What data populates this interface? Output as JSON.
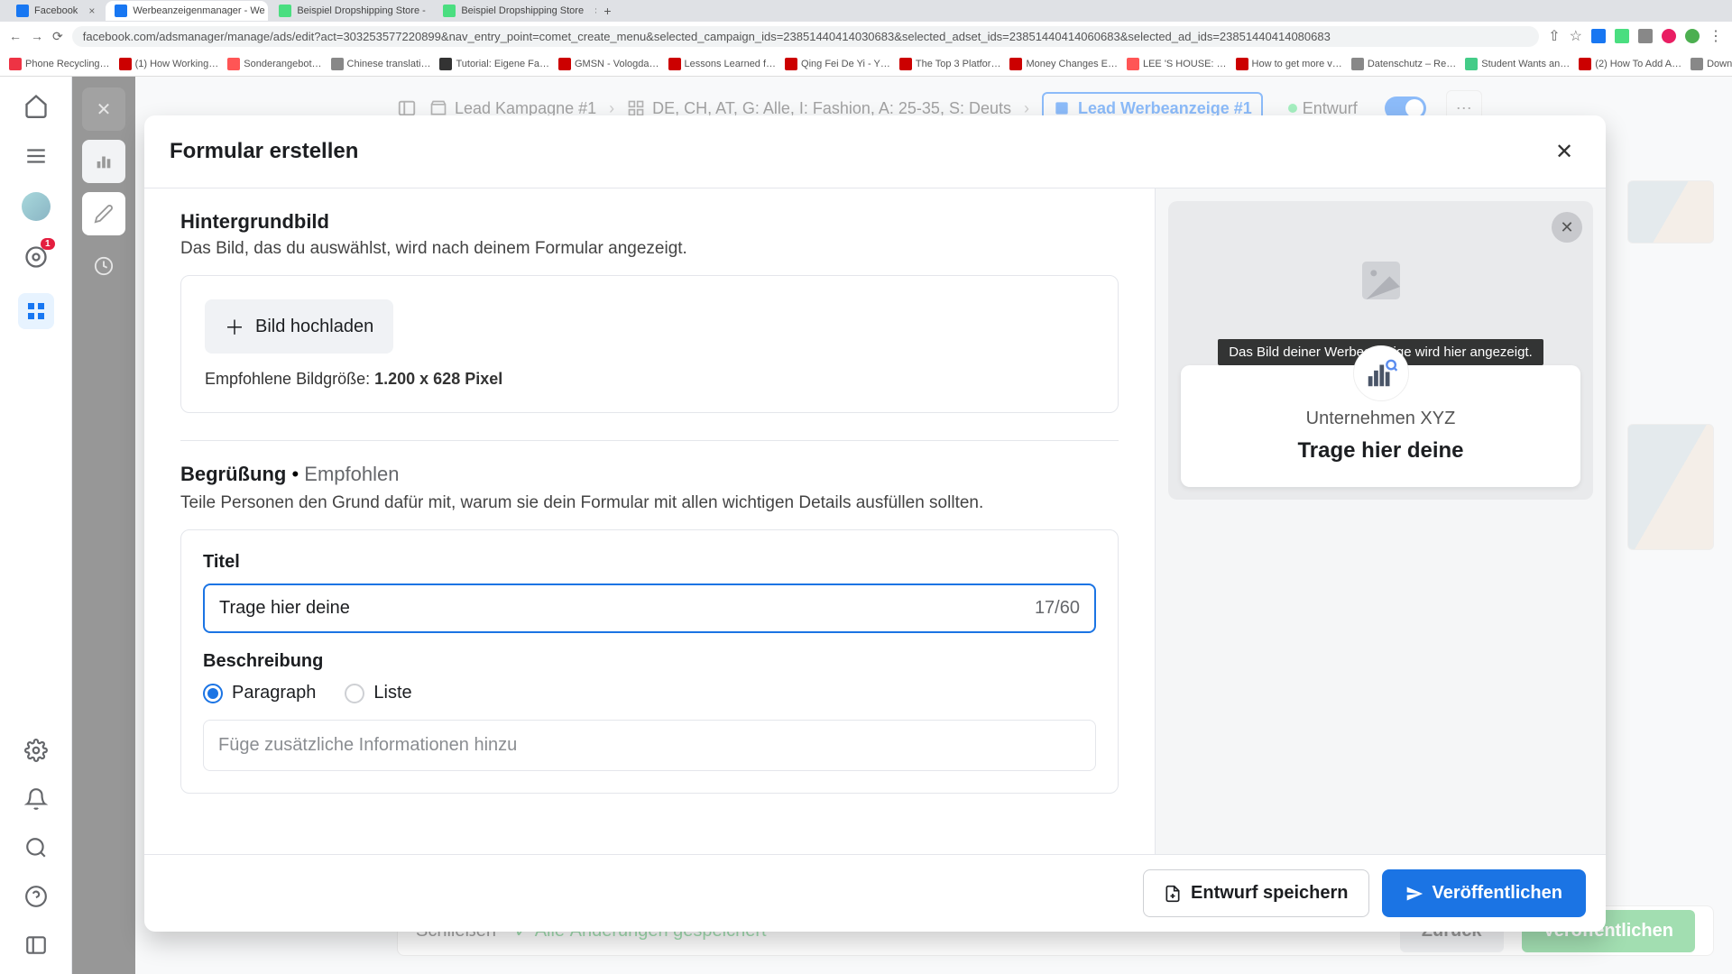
{
  "browser": {
    "tabs": [
      {
        "label": "Facebook"
      },
      {
        "label": "Werbeanzeigenmanager - We"
      },
      {
        "label": "Beispiel Dropshipping Store -"
      },
      {
        "label": "Beispiel Dropshipping Store"
      }
    ],
    "url": "facebook.com/adsmanager/manage/ads/edit?act=303253577220899&nav_entry_point=comet_create_menu&selected_campaign_ids=23851440414030683&selected_adset_ids=23851440414060683&selected_ad_ids=23851440414080683",
    "bookmarks": [
      "Phone Recycling…",
      "(1) How Working…",
      "Sonderangebot…",
      "Chinese translati…",
      "Tutorial: Eigene Fa…",
      "GMSN - Vologda…",
      "Lessons Learned f…",
      "Qing Fei De Yi - Y…",
      "The Top 3 Platfor…",
      "Money Changes E…",
      "LEE 'S HOUSE: …",
      "How to get more v…",
      "Datenschutz – Re…",
      "Student Wants an…",
      "(2) How To Add A…",
      "Download - Cooki…"
    ]
  },
  "fb_rail": {
    "notification_count": "1"
  },
  "editor_bar": {
    "crumb1": "Lead Kampagne #1",
    "crumb2": "DE, CH, AT, G: Alle, I: Fashion, A: 25-35, S: Deuts",
    "crumb3": "Lead Werbeanzeige #1",
    "status": "Entwurf"
  },
  "bottom_bar": {
    "close": "Schließen",
    "saved": "Alle Änderungen gespeichert",
    "back": "Zurück",
    "publish": "Veröffentlichen"
  },
  "modal": {
    "title": "Formular erstellen",
    "bg_section": {
      "title": "Hintergrundbild",
      "subtitle": "Das Bild, das du auswählst, wird nach deinem Formular angezeigt.",
      "upload_label": "Bild hochladen",
      "rec_prefix": "Empfohlene Bildgröße: ",
      "rec_value": "1.200 x 628 Pixel"
    },
    "greet_section": {
      "title": "Begrüßung",
      "sep": " • ",
      "rec": "Empfohlen",
      "subtitle": "Teile Personen den Grund dafür mit, warum sie dein Formular mit allen wichtigen Details ausfüllen sollten.",
      "title_label": "Titel",
      "title_value": "Trage hier deine ",
      "title_counter": "17/60",
      "desc_label": "Beschreibung",
      "radio_paragraph": "Paragraph",
      "radio_list": "Liste",
      "desc_placeholder": "Füge zusätzliche Informationen hinzu"
    },
    "preview": {
      "tooltip": "Das Bild deiner Werbeanzeige wird hier angezeigt.",
      "company": "Unternehmen XYZ",
      "title": "Trage hier deine"
    },
    "footer": {
      "draft": "Entwurf speichern",
      "publish": "Veröffentlichen"
    }
  }
}
